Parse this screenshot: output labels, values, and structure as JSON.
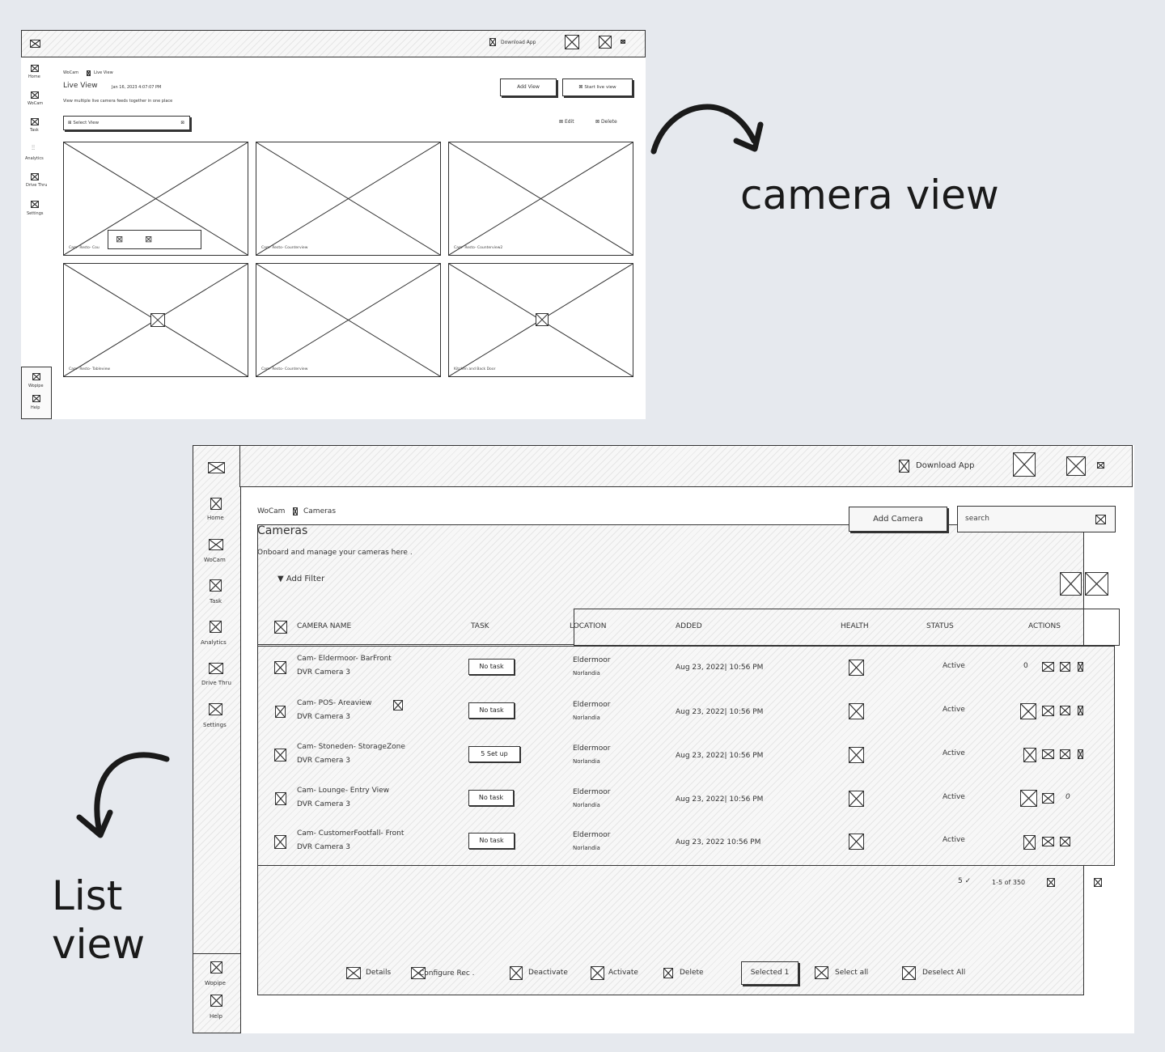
{
  "annotations": {
    "camera_view": "camera view",
    "list_view_line1": "List",
    "list_view_line2": "view"
  },
  "camera_view": {
    "topbar": {
      "download": "Download App"
    },
    "sidebar": {
      "items": [
        "Home",
        "WoCam",
        "Task",
        "Analytics",
        "Drive Thru",
        "Settings"
      ],
      "bottom": [
        "Wopipe",
        "Help"
      ]
    },
    "breadcrumb": {
      "root": "WoCam",
      "current": "Live View"
    },
    "title": "Live View",
    "timestamp": "Jan 16, 2023 4:07:07 PM",
    "subtitle": "View multiple live camera feeds together in one place",
    "select_view": "Select View",
    "add_view": "Add View",
    "start_live_view": "Start live view",
    "edit": "Edit",
    "delete": "Delete",
    "feeds": [
      "Cam- Resto- Cou",
      "Cam- Resto- Counterview",
      "Cam- Resto- Counterview2",
      "Cam- Resto- Tableview",
      "Cam- Resto- Counterview",
      "Kitchen and Back Door"
    ]
  },
  "list_view": {
    "topbar": {
      "download": "Download App"
    },
    "sidebar": {
      "items": [
        "Home",
        "WoCam",
        "Task",
        "Analytics",
        "Drive Thru",
        "Settings"
      ],
      "bottom": [
        "Wopipe",
        "Help"
      ]
    },
    "breadcrumb": {
      "root": "WoCam",
      "current": "Cameras"
    },
    "add_camera": "Add Camera",
    "search_placeholder": "search",
    "title": "Cameras",
    "subtitle": "Onboard and manage your cameras here .",
    "add_filter": "▼ Add Filter",
    "columns": [
      "CAMERA NAME",
      "TASK",
      "LOCATION",
      "ADDED",
      "HEALTH",
      "STATUS",
      "ACTIONS"
    ],
    "rows": [
      {
        "name": "Cam- Eldermoor- BarFront",
        "sub": "DVR Camera 3",
        "task": "No task",
        "location": "Eldermoor",
        "region": "Norlandia",
        "added": "Aug 23, 2022| 10:56 PM",
        "status": "Active"
      },
      {
        "name": "Cam- POS- Areaview",
        "sub": "DVR Camera 3",
        "task": "No task",
        "location": "Eldermoor",
        "region": "Norlandia",
        "added": "Aug 23, 2022| 10:56 PM",
        "status": "Active"
      },
      {
        "name": "Cam- Stoneden- StorageZone",
        "sub": "DVR Camera 3",
        "task": "5 Set up",
        "location": "Eldermoor",
        "region": "Norlandia",
        "added": "Aug 23, 2022| 10:56 PM",
        "status": "Active"
      },
      {
        "name": "Cam- Lounge- Entry View",
        "sub": "DVR Camera 3",
        "task": "No task",
        "location": "Eldermoor",
        "region": "Norlandia",
        "added": "Aug 23, 2022| 10:56 PM",
        "status": "Active"
      },
      {
        "name": "Cam- CustomerFootfall- Front",
        "sub": "DVR Camera 3",
        "task": "No task",
        "location": "Eldermoor",
        "region": "Norlandia",
        "added": "Aug 23, 2022 10:56 PM",
        "status": "Active"
      }
    ],
    "pagination": {
      "per_page": "5 ✓",
      "range": "1-5 of 350"
    },
    "bulk_actions": {
      "details": "Details",
      "configure": "Configure Rec .",
      "deactivate": "Deactivate",
      "activate": "Activate",
      "delete": "Delete",
      "selected": "Selected 1",
      "select_all": "Select all",
      "deselect_all": "Deselect All"
    },
    "row_first_action": "0",
    "row4_action": "0"
  }
}
